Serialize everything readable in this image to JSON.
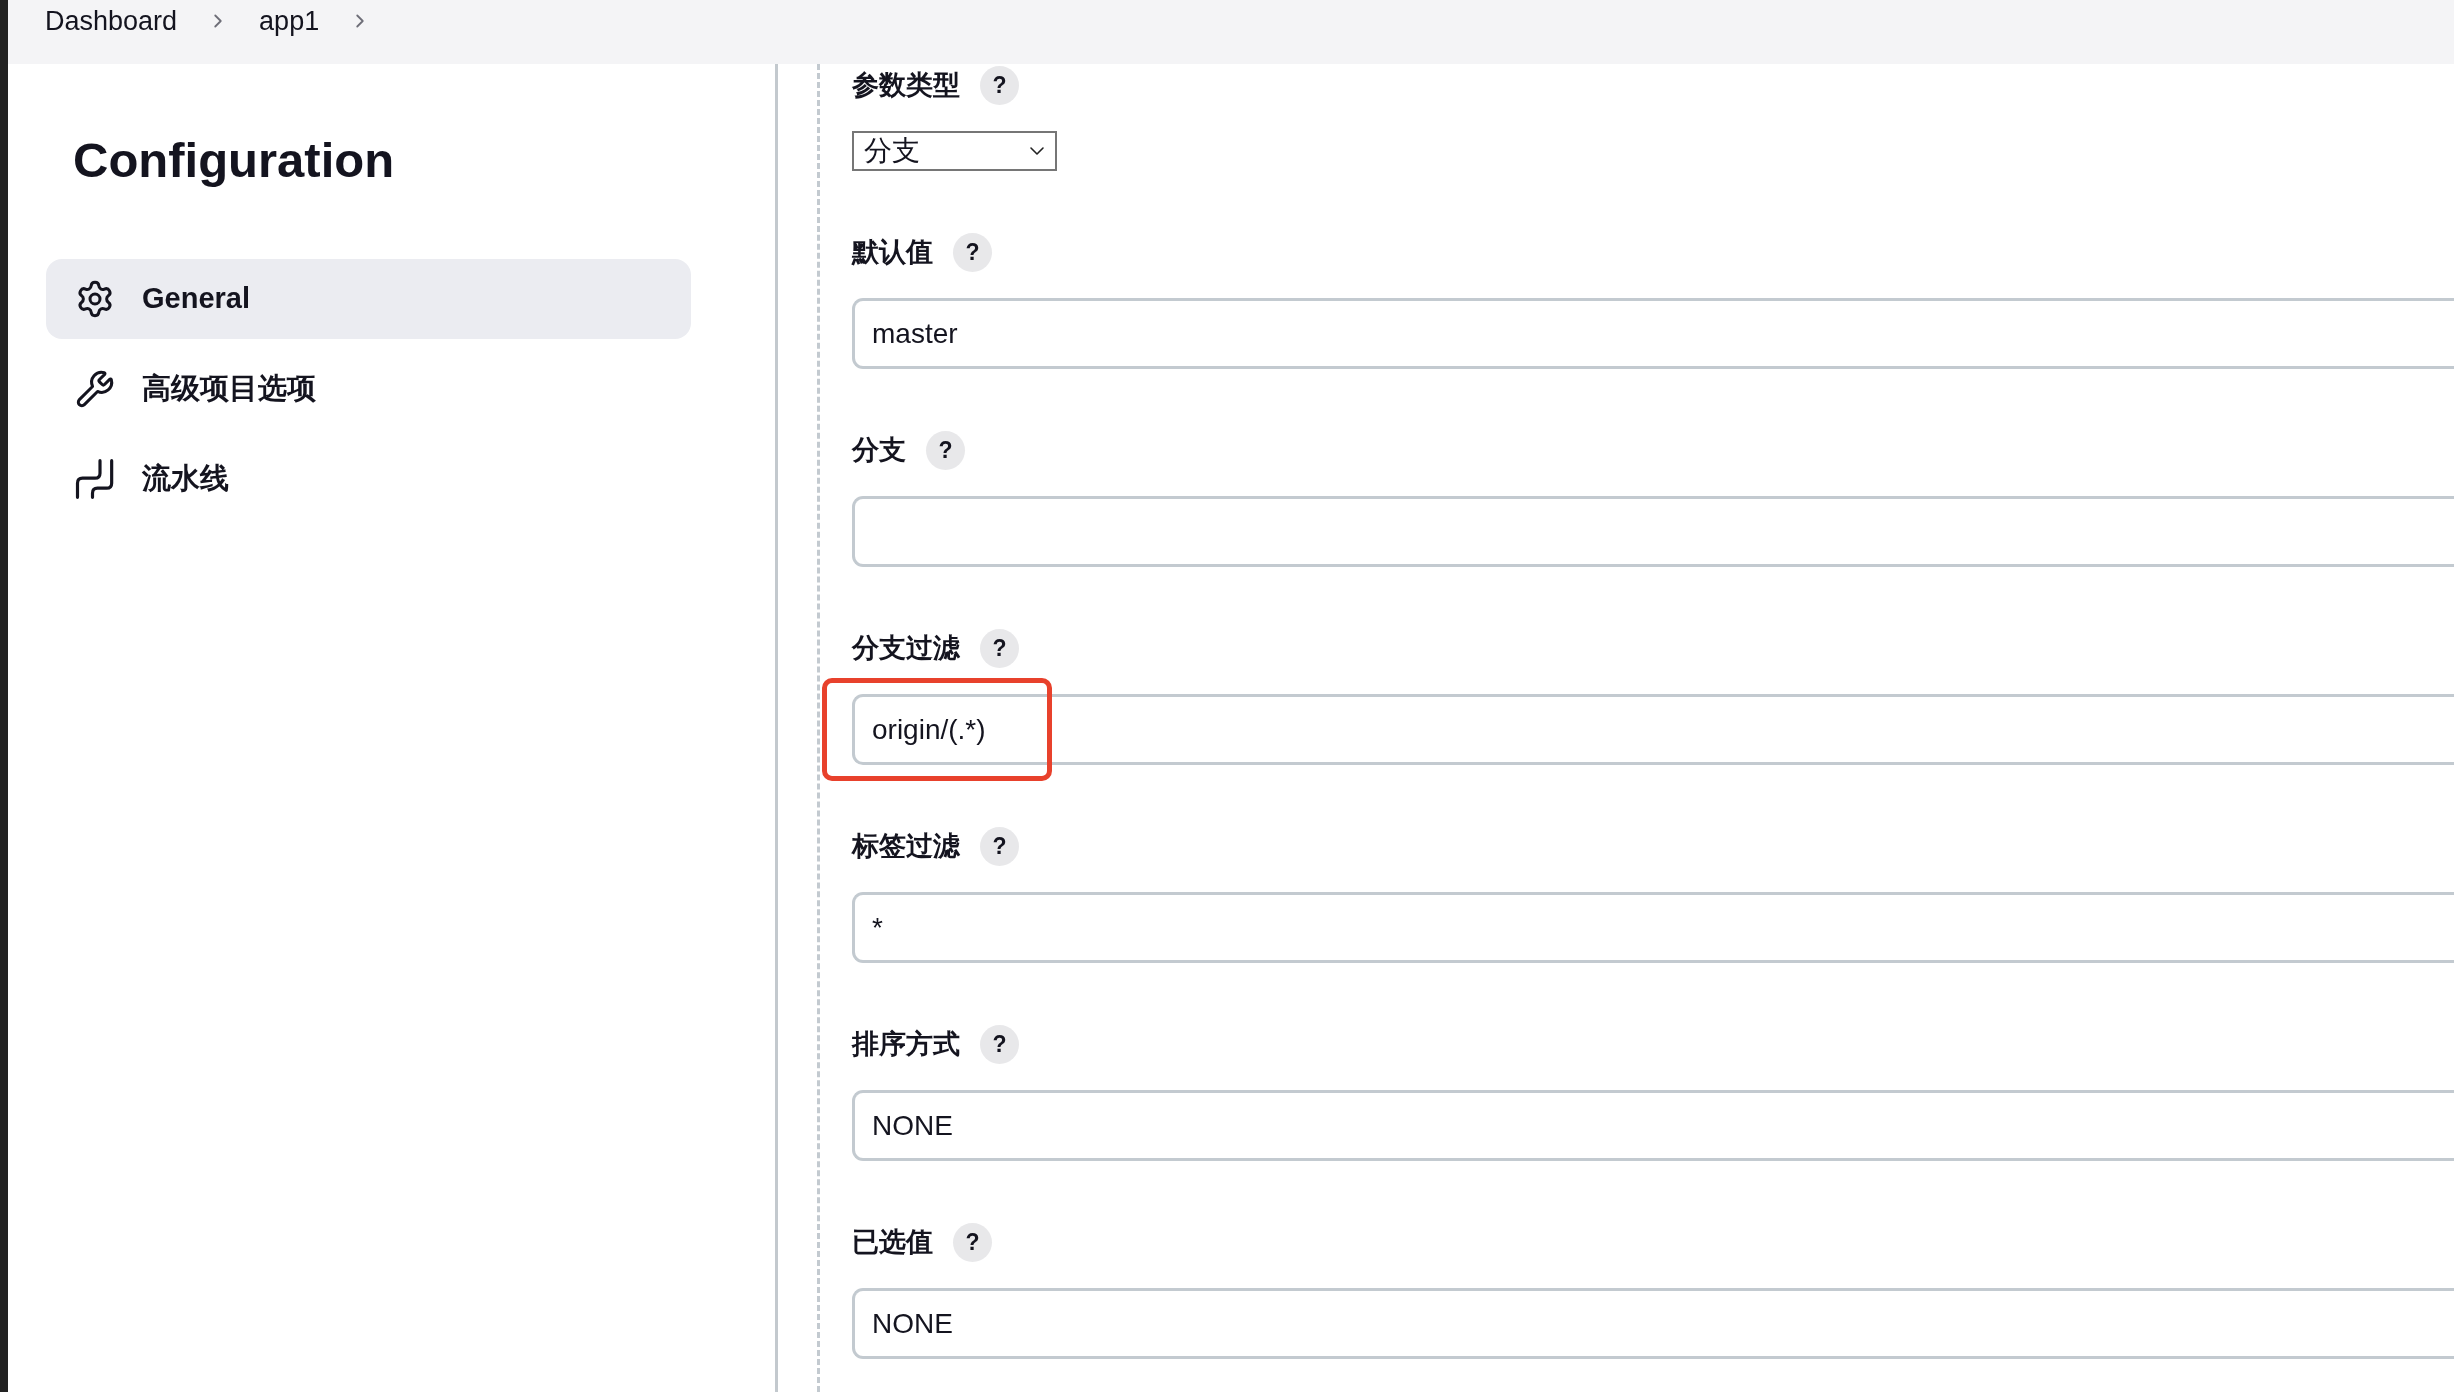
{
  "breadcrumbs": [
    {
      "label": "Dashboard"
    },
    {
      "label": "app1"
    }
  ],
  "sidebar": {
    "title": "Configuration",
    "items": [
      {
        "kind": "gear",
        "label": "General",
        "selected": true
      },
      {
        "kind": "wrench",
        "label": "高级项目选项",
        "selected": false
      },
      {
        "kind": "pipeline",
        "label": "流水线",
        "selected": false
      }
    ]
  },
  "fields": [
    {
      "kind": "select",
      "label": "参数类型",
      "help": "?",
      "value": "分支",
      "highlighted": false
    },
    {
      "kind": "text",
      "label": "默认值",
      "help": "?",
      "value": "master",
      "highlighted": false
    },
    {
      "kind": "text",
      "label": "分支",
      "help": "?",
      "highlighted": false
    },
    {
      "kind": "text",
      "label": "分支过滤",
      "help": "?",
      "value": "origin/(.*)",
      "highlighted": true
    },
    {
      "kind": "text",
      "label": "标签过滤",
      "help": "?",
      "value": "*",
      "highlighted": false
    },
    {
      "kind": "text",
      "label": "排序方式",
      "help": "?",
      "value": "NONE",
      "highlighted": false
    },
    {
      "kind": "text",
      "label": "已选值",
      "help": "?",
      "value": "NONE",
      "highlighted": false
    }
  ]
}
